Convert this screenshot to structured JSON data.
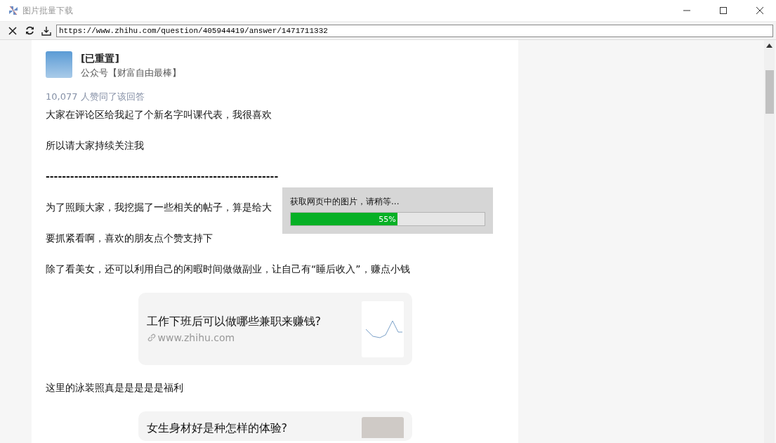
{
  "window": {
    "title": "图片批量下载"
  },
  "toolbar": {
    "url": "https://www.zhihu.com/question/405944419/answer/1471711332"
  },
  "answer": {
    "author": "[已重置]",
    "author_bio": "公众号【财富自由最棒】",
    "votes": "10,077 人赞同了该回答",
    "blocks": [
      {
        "kind": "text",
        "text": "大家在评论区给我起了个新名字叫课代表，我很喜欢"
      },
      {
        "kind": "text",
        "text": "所以请大家持续关注我"
      },
      {
        "kind": "divider",
        "text": "---------------------------------------------------------"
      },
      {
        "kind": "text",
        "text": "为了照顾大家，我挖掘了一些相关的帖子，算是给大"
      },
      {
        "kind": "text",
        "text": "要抓紧看啊，喜欢的朋友点个赞支持下"
      },
      {
        "kind": "text",
        "text": "除了看美女，还可以利用自己的闲暇时间做做副业，让自己有“睡后收入”，赚点小钱"
      },
      {
        "kind": "card",
        "title": "工作下班后可以做哪些兼职来赚钱?",
        "url": "www.zhihu.com",
        "thumbnail": {
          "kind": "chart"
        }
      },
      {
        "kind": "text",
        "text": "这里的泳装照真是是是是是福利"
      },
      {
        "kind": "card",
        "title": "女生身材好是种怎样的体验?",
        "thumbnail": {
          "kind": "photo"
        }
      }
    ]
  },
  "dialog": {
    "message": "获取网页中的图片，请稍等...",
    "progress": {
      "level": 0.55,
      "reading": "55%"
    }
  }
}
